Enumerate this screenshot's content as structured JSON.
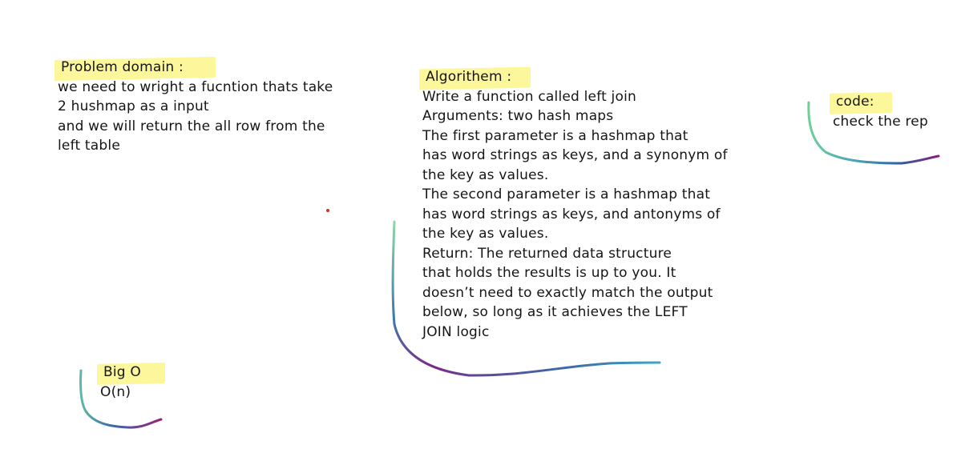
{
  "problem": {
    "heading": "Problem domain :",
    "lines": [
      "we need to wright a fucntion thats take",
      "2 hushmap as a input",
      "and we will return the all row from the",
      "left table"
    ]
  },
  "algorithm": {
    "heading": "Algorithem :",
    "lines": [
      "Write a function called left join",
      "Arguments: two hash maps",
      "The first parameter is a hashmap that",
      "has word strings as keys, and a synonym of",
      "the key as values.",
      "The second parameter is a hashmap that",
      "has word strings as keys, and antonyms of",
      "the key as values.",
      "Return: The returned data structure",
      "that holds the results is up to you. It",
      "doesn’t need to exactly match the output",
      "below, so long as it achieves the LEFT",
      "JOIN logic"
    ]
  },
  "code": {
    "heading": "code:",
    "lines": [
      "check the rep"
    ]
  },
  "bigo": {
    "heading": "Big O",
    "lines": [
      "O(n)"
    ]
  },
  "colors": {
    "highlight": "#fbf79a",
    "stroke_start": "#7fd39a",
    "stroke_mid": "#2f6fa6",
    "stroke_end": "#8a1f7a",
    "dot": "#d6302a"
  }
}
